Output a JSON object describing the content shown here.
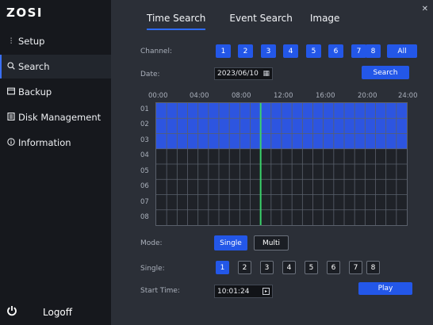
{
  "sidebar": {
    "logo": "ZOSI",
    "items": [
      {
        "label": "Setup",
        "icon": "sliders-icon"
      },
      {
        "label": "Search",
        "icon": "search-icon"
      },
      {
        "label": "Backup",
        "icon": "backup-icon"
      },
      {
        "label": "Disk Management",
        "icon": "disk-icon"
      },
      {
        "label": "Information",
        "icon": "info-icon"
      }
    ],
    "active_index": 1,
    "logoff_label": "Logoff"
  },
  "tabs": [
    {
      "label": "Time Search",
      "active": true
    },
    {
      "label": "Event Search",
      "active": false
    },
    {
      "label": "Image",
      "active": false
    }
  ],
  "channel": {
    "label": "Channel:",
    "buttons": [
      "1",
      "2",
      "3",
      "4",
      "5",
      "6",
      "7",
      "8"
    ],
    "all_label": "All"
  },
  "date": {
    "label": "Date:",
    "value": "2023/06/10"
  },
  "search_button": "Search",
  "timeline": {
    "time_labels": [
      "00:00",
      "04:00",
      "08:00",
      "12:00",
      "16:00",
      "20:00",
      "24:00"
    ],
    "rows": [
      "01",
      "02",
      "03",
      "04",
      "05",
      "06",
      "07",
      "08"
    ],
    "recorded_rows": [
      0,
      1,
      2
    ],
    "hours": 24,
    "cursor_hour": 10.0,
    "colors": {
      "recording": "#2d55e0",
      "cursor": "#3ad36a",
      "grid": "#5a606b",
      "empty": "#1f2228"
    }
  },
  "mode": {
    "label": "Mode:",
    "options": [
      "Single",
      "Multi"
    ],
    "selected": 0
  },
  "single": {
    "label": "Single:",
    "buttons": [
      "1",
      "2",
      "3",
      "4",
      "5",
      "6",
      "7",
      "8"
    ],
    "selected": 0
  },
  "start_time": {
    "label": "Start Time:",
    "value": "10:01:24"
  },
  "play_button": "Play"
}
